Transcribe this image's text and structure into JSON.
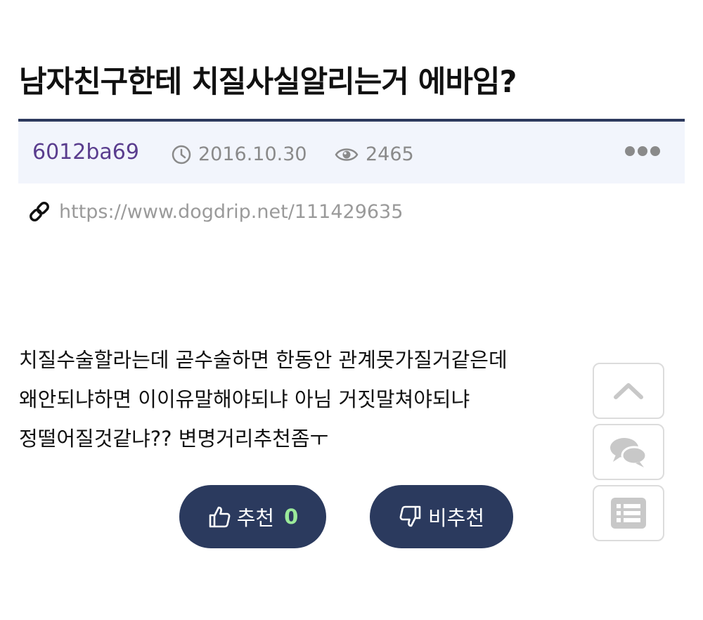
{
  "post": {
    "title": "남자친구한테 치질사실알리는거 에바임?",
    "author": "6012ba69",
    "date": "2016.10.30",
    "views": "2465",
    "link": "https://www.dogdrip.net/111429635",
    "body_lines": [
      "치질수술할라는데 곧수술하면 한동안 관계못가질거같은데",
      "왜안되냐하면 이이유말해야되냐 아님 거짓말쳐야되냐",
      "정떨어질것같냐?? 변명거리추천좀ㅜ"
    ]
  },
  "votes": {
    "up_label": "추천",
    "up_count": "0",
    "down_label": "비추천"
  },
  "icons": {
    "clock": "clock-icon",
    "eye": "eye-icon",
    "more": "more-icon",
    "link": "link-icon",
    "thumbs_up": "thumbs-up-icon",
    "thumbs_down": "thumbs-down-icon",
    "scroll_top": "chevron-up-icon",
    "comments": "comments-icon",
    "list": "list-icon"
  },
  "colors": {
    "accent": "#2b3a5e",
    "author": "#5a3d8e",
    "meta_bg": "#f2f5fc",
    "vote_count": "#9bea9a"
  }
}
